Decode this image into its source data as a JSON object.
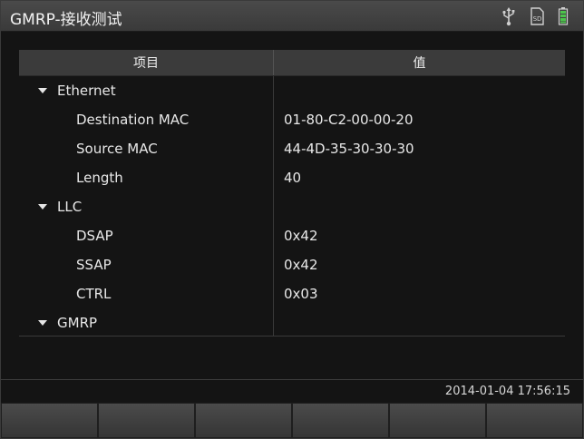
{
  "window": {
    "title": "GMRP-接收测试"
  },
  "status_icons": [
    "usb-icon",
    "sd-card-icon",
    "battery-icon"
  ],
  "colors": {
    "background": "#141414",
    "titlebar": "#3a3a3a",
    "header": "#3b3b3b",
    "battery": "#4cc44c"
  },
  "table": {
    "headers": [
      "项目",
      "值"
    ],
    "rows": [
      {
        "type": "group",
        "name": "Ethernet",
        "value": ""
      },
      {
        "type": "child",
        "name": "Destination MAC",
        "value": "01-80-C2-00-00-20"
      },
      {
        "type": "child",
        "name": "Source MAC",
        "value": "44-4D-35-30-30-30"
      },
      {
        "type": "child",
        "name": "Length",
        "value": "40"
      },
      {
        "type": "group",
        "name": "LLC",
        "value": ""
      },
      {
        "type": "child",
        "name": "DSAP",
        "value": "0x42"
      },
      {
        "type": "child",
        "name": "SSAP",
        "value": "0x42"
      },
      {
        "type": "child",
        "name": "CTRL",
        "value": "0x03"
      },
      {
        "type": "group",
        "name": "GMRP",
        "value": ""
      }
    ]
  },
  "status": {
    "datetime": "2014-01-04 17:56:15"
  },
  "softkeys": [
    "",
    "",
    "",
    "",
    "",
    ""
  ]
}
